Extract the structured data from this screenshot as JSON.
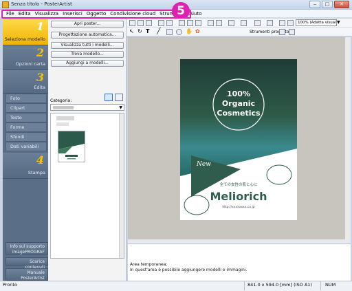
{
  "window": {
    "title": "Senza titolo - PosterArtist",
    "minimize": "‒",
    "maximize": "□",
    "close": "✕"
  },
  "menu": [
    "File",
    "Edita",
    "Visualizza",
    "Inserisci",
    "Oggetto",
    "Condivisione cloud",
    "Strumento",
    "Aiuto"
  ],
  "annotation": {
    "step": "5",
    "color": "#e020b0"
  },
  "steps": [
    {
      "num": "1",
      "label": "Seleziona modello"
    },
    {
      "num": "2",
      "label": "Opzioni carta"
    },
    {
      "num": "3",
      "label": "Edita"
    },
    {
      "num": "4",
      "label": "Stampa"
    }
  ],
  "edit_items": [
    "Foto",
    "Clipart",
    "Testo",
    "Forme",
    "Sfondi",
    "Dati variabili"
  ],
  "bottom_buttons": [
    {
      "line1": "Info sul supporto",
      "line2": "imagePROGRAF"
    },
    {
      "line1": "Scarica contenuti",
      "line2": ""
    },
    {
      "line1": "Manuale",
      "line2": "PosterArtist"
    }
  ],
  "template_panel": {
    "buttons": [
      "Apri poster...",
      "Progettazione automatica...",
      "Visualizza tutti i modelli...",
      "Trova modello...",
      "Aggiungi a modelli..."
    ],
    "category_label": "Categoria:"
  },
  "toolbar": {
    "zoom_value": "100% (Adatta visualiz.)",
    "tools_label": "Strumenti progetto"
  },
  "poster": {
    "headline1": "100%",
    "headline2": "Organic",
    "headline3": "Cosmetics",
    "tag": "New",
    "jp_text": "全ての女性の肌と心に",
    "brand": "Meliorich",
    "url": "http://xxxxxxxx.co.jp"
  },
  "info": {
    "line1": "Area temporanea:",
    "line2": "In quest'area è possibile aggiungere modelli e immagini."
  },
  "status": {
    "left": "Pronto",
    "size": "841.0 x 594.0 [mm] (ISO A1)",
    "num": "NUM"
  }
}
